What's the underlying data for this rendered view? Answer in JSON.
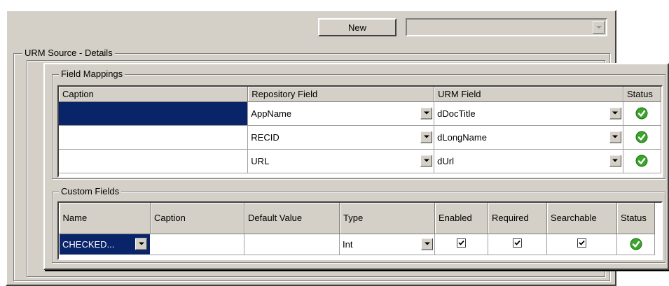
{
  "toolbar": {
    "new_label": "New",
    "combo_value": ""
  },
  "urm_source": {
    "label": "URM Source - Details"
  },
  "field_mappings": {
    "label": "Field Mappings",
    "columns": [
      "Caption",
      "Repository Field",
      "URM Field",
      "Status"
    ],
    "rows": [
      {
        "caption": "",
        "repository_field": "AppName",
        "urm_field": "dDocTitle",
        "status": "ok",
        "selected": true
      },
      {
        "caption": "",
        "repository_field": "RECID",
        "urm_field": "dLongName",
        "status": "ok",
        "selected": false
      },
      {
        "caption": "",
        "repository_field": "URL",
        "urm_field": "dUrl",
        "status": "ok",
        "selected": false
      }
    ]
  },
  "custom_fields": {
    "label": "Custom Fields",
    "columns": [
      "Name",
      "Caption",
      "Default Value",
      "Type",
      "Enabled",
      "Required",
      "Searchable",
      "Status"
    ],
    "rows": [
      {
        "name": "CHECKED...",
        "caption": "",
        "default_value": "",
        "type": "Int",
        "enabled": true,
        "required": true,
        "searchable": true,
        "status": "ok"
      }
    ]
  },
  "icons": {
    "dropdown": "chevron-down-icon",
    "status_ok": "green-check-icon",
    "checkbox_checked": "checkmark-icon"
  },
  "colors": {
    "panel_bg": "#d4d0c8",
    "selection": "#0a246a",
    "status_green": "#3aa52a"
  }
}
